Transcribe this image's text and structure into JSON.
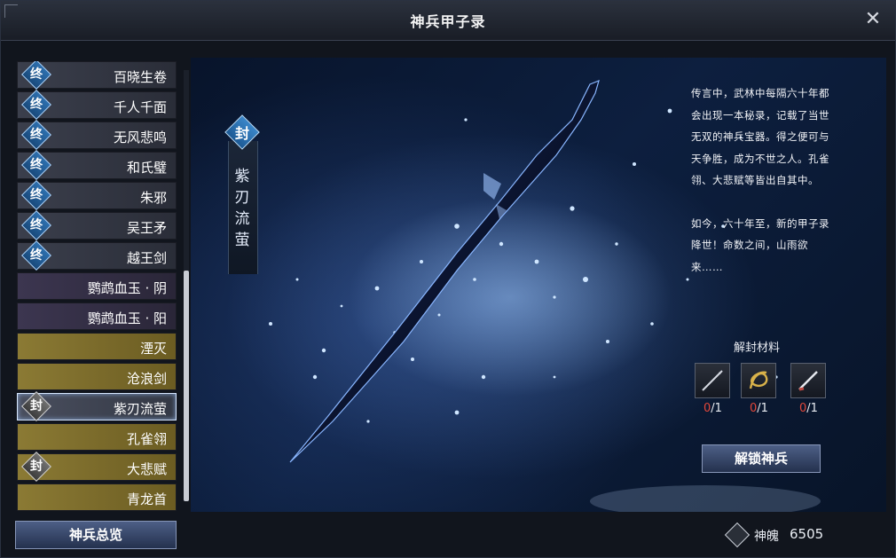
{
  "window": {
    "title": "神兵甲子录"
  },
  "list": {
    "items": [
      {
        "badge": "终",
        "label": "百晓生卷",
        "style": "gray"
      },
      {
        "badge": "终",
        "label": "千人千面",
        "style": "gray"
      },
      {
        "badge": "终",
        "label": "无风悲鸣",
        "style": "gray"
      },
      {
        "badge": "终",
        "label": "和氏璧",
        "style": "gray"
      },
      {
        "badge": "终",
        "label": "朱邪",
        "style": "gray"
      },
      {
        "badge": "终",
        "label": "吴王矛",
        "style": "gray"
      },
      {
        "badge": "终",
        "label": "越王剑",
        "style": "gray"
      },
      {
        "badge": "",
        "label": "鹦鹉血玉 · 阴",
        "style": "purple"
      },
      {
        "badge": "",
        "label": "鹦鹉血玉 · 阳",
        "style": "purple"
      },
      {
        "badge": "",
        "label": "湮灭",
        "style": "gold"
      },
      {
        "badge": "",
        "label": "沧浪剑",
        "style": "gold"
      },
      {
        "badge": "封",
        "label": "紫刃流萤",
        "style": "selected"
      },
      {
        "badge": "",
        "label": "孔雀翎",
        "style": "gold"
      },
      {
        "badge": "封",
        "label": "大悲赋",
        "style": "gold"
      },
      {
        "badge": "",
        "label": "青龙首",
        "style": "gold"
      }
    ]
  },
  "weapon": {
    "seal": "封",
    "name": "紫刃流萤"
  },
  "lore": {
    "p1": "传言中，武林中每隔六十年都会出现一本秘录，记载了当世无双的神兵宝器。得之便可与天争胜，成为不世之人。孔雀翎、大悲赋等皆出自其中。",
    "p2": "如今，六十年至，新的甲子录降世！命数之间，山雨欲来……"
  },
  "materials": {
    "title": "解封材料",
    "slots": [
      {
        "icon": "needle-icon",
        "have": "0",
        "need": "/1"
      },
      {
        "icon": "golden-rope-icon",
        "have": "0",
        "need": "/1"
      },
      {
        "icon": "blade-icon",
        "have": "0",
        "need": "/1"
      }
    ]
  },
  "buttons": {
    "unlock": "解锁神兵",
    "overview": "神兵总览"
  },
  "currency": {
    "label": "神魄",
    "value": "6505"
  }
}
